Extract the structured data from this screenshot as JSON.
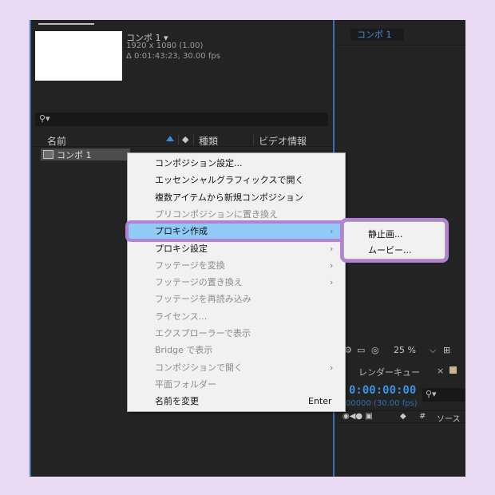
{
  "project": {
    "comp_name": "コンポ 1 ▾",
    "comp_resolution": "1920 x 1080 (1.00)",
    "comp_duration": "Δ 0:01:43:23, 30.00 fps",
    "search_icon": "⚲▾",
    "columns": {
      "name": "名前",
      "type": "種類",
      "video_info": "ビデオ情報"
    },
    "row": {
      "label": "コンポ 1"
    }
  },
  "viewer": {
    "tab_label": "コンポ 1",
    "zoom": "25 %",
    "render_queue_tab": "レンダーキュー",
    "close": "×"
  },
  "timeline": {
    "timecode": "0:00:00:00",
    "fps": "00000 (30.00 fps)",
    "header_hash": "#",
    "header_source": "ソース"
  },
  "context_menu": {
    "items": [
      {
        "label": "コンポジション設定...",
        "enabled": true
      },
      {
        "label": "エッセンシャルグラフィックスで開く",
        "enabled": true
      },
      {
        "label": "複数アイテムから新規コンポジション",
        "enabled": true
      },
      {
        "label": "プリコンポジションに置き換え",
        "enabled": false
      },
      {
        "label": "プロキシ作成",
        "enabled": true,
        "submenu": true,
        "highlighted": true
      },
      {
        "label": "プロキシ設定",
        "enabled": true,
        "submenu": true
      },
      {
        "label": "フッテージを変換",
        "enabled": false,
        "submenu": true
      },
      {
        "label": "フッテージの置き換え",
        "enabled": false,
        "submenu": true
      },
      {
        "label": "フッテージを再読み込み",
        "enabled": false
      },
      {
        "label": "ライセンス...",
        "enabled": false
      },
      {
        "label": "エクスプローラーで表示",
        "enabled": false
      },
      {
        "label": "Bridge で表示",
        "enabled": false
      },
      {
        "label": "コンポジションで開く",
        "enabled": false,
        "submenu": true
      },
      {
        "label": "平面フォルダー",
        "enabled": false
      },
      {
        "label": "名前を変更",
        "enabled": true,
        "shortcut": "Enter"
      }
    ],
    "submenu_arrow": "›"
  },
  "proxy_submenu": {
    "items": [
      {
        "label": "静止画..."
      },
      {
        "label": "ムービー..."
      }
    ]
  },
  "colors": {
    "accent_blue": "#3d8fe0",
    "highlight": "#91c9f7",
    "annotation_purple": "#b382d4",
    "background_lavender": "#e9d9f3"
  }
}
